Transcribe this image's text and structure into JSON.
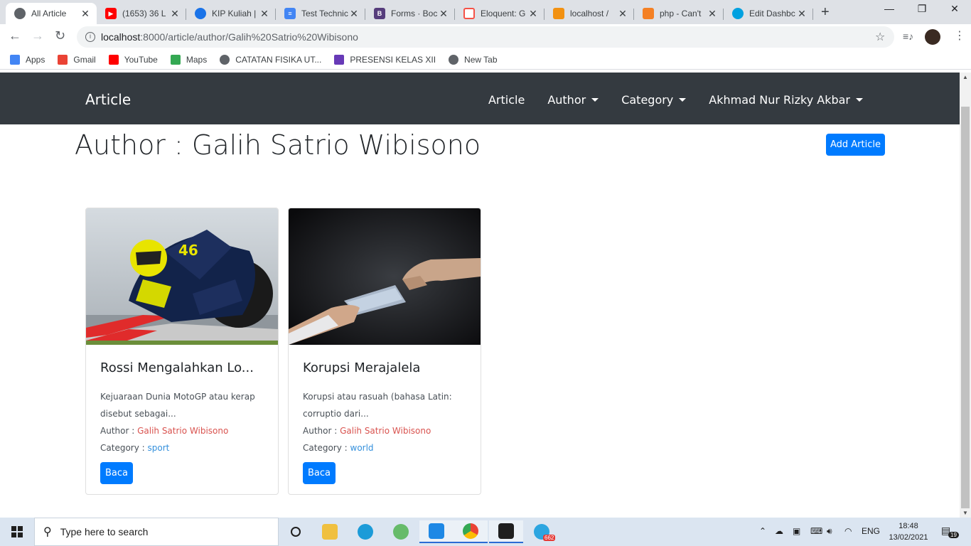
{
  "browser": {
    "tabs": [
      {
        "title": "All Article",
        "icon": "globe-icon",
        "color": "#5f6368",
        "active": true
      },
      {
        "title": "(1653) 36 L",
        "icon": "youtube-icon",
        "color": "#ff0000"
      },
      {
        "title": "KIP Kuliah |",
        "icon": "kip-icon",
        "color": "#1a73e8"
      },
      {
        "title": "Test Technic",
        "icon": "forms-icon",
        "color": "#4285f4"
      },
      {
        "title": "Forms · Boc",
        "icon": "bootstrap-icon",
        "color": "#563d7c"
      },
      {
        "title": "Eloquent: G",
        "icon": "laravel-icon",
        "color": "#f55247"
      },
      {
        "title": "localhost / ",
        "icon": "phpmyadmin-icon",
        "color": "#f29111"
      },
      {
        "title": "php - Can't ",
        "icon": "stackoverflow-icon",
        "color": "#f48024"
      },
      {
        "title": "Edit Dashbc",
        "icon": "salesforce-icon",
        "color": "#00a1e0"
      }
    ],
    "url_host": "localhost",
    "url_path": ":8000/article/author/Galih%20Satrio%20Wibisono",
    "bookmarks": [
      {
        "label": "Apps",
        "icon": "apps-grid-icon",
        "color": "#4285f4"
      },
      {
        "label": "Gmail",
        "icon": "gmail-icon",
        "color": "#ea4335"
      },
      {
        "label": "YouTube",
        "icon": "youtube-icon",
        "color": "#ff0000"
      },
      {
        "label": "Maps",
        "icon": "maps-icon",
        "color": "#34a853"
      },
      {
        "label": "CATATAN FISIKA UT...",
        "icon": "globe-icon",
        "color": "#5f6368"
      },
      {
        "label": "PRESENSI KELAS XII",
        "icon": "forms-icon",
        "color": "#673ab7"
      },
      {
        "label": "New Tab",
        "icon": "globe-icon",
        "color": "#5f6368"
      }
    ]
  },
  "app": {
    "brand": "Article",
    "nav": {
      "article": "Article",
      "author": "Author",
      "category": "Category",
      "user": "Akhmad Nur Rizky Akbar"
    },
    "page_title": "Author : Galih Satrio Wibisono",
    "add_button": "Add Article",
    "author_label": "Author : ",
    "category_label": "Category : ",
    "cards": [
      {
        "title": "Rossi Mengalahkan Lo...",
        "desc_line1": "Kejuaraan Dunia MotoGP atau kerap",
        "desc_line2": "disebut sebagai...",
        "author": "Galih Satrio Wibisono",
        "category": "sport",
        "button": "Baca",
        "image": "motogp-rider-image"
      },
      {
        "title": "Korupsi Merajalela",
        "desc_line1": "Korupsi atau rasuah (bahasa Latin:",
        "desc_line2": "corruptio dari...",
        "author": "Galih Satrio Wibisono",
        "category": "world",
        "button": "Baca",
        "image": "bribe-handover-image"
      }
    ]
  },
  "taskbar": {
    "search_placeholder": "Type here to search",
    "lang": "ENG",
    "time": "18:48",
    "date": "13/02/2021",
    "notifications": "19",
    "telegram_badge": "662"
  }
}
